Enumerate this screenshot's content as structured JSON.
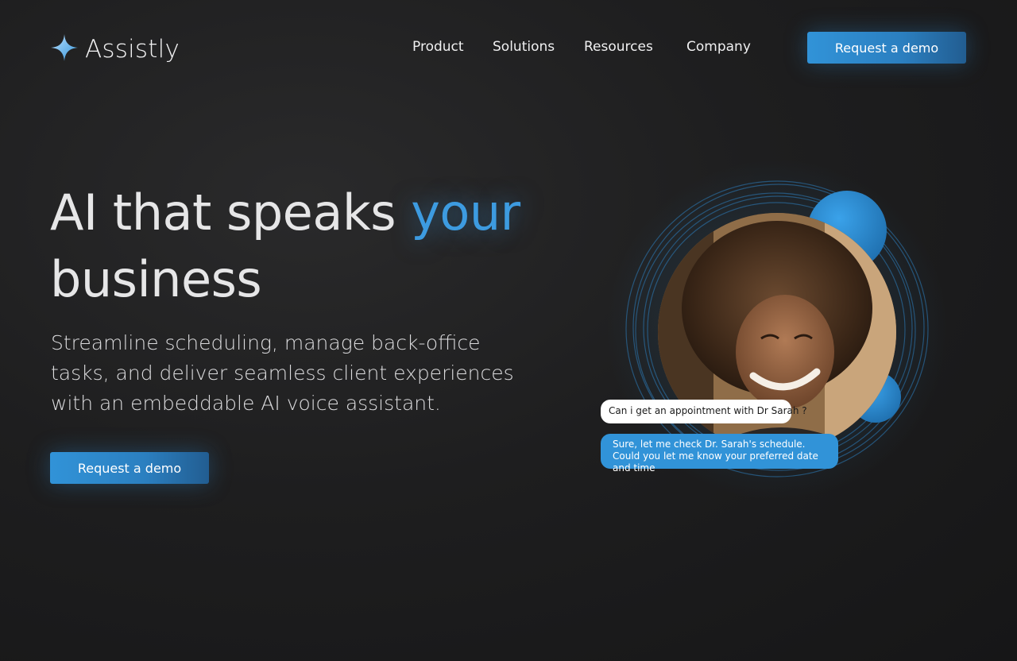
{
  "header": {
    "logo_text": "Assistly",
    "nav": [
      "Product",
      "Solutions",
      "Resources",
      "Company"
    ],
    "cta_label": "Request a demo"
  },
  "hero": {
    "title_part1": "AI that speaks ",
    "title_accent": "your",
    "title_part2": "business",
    "subtitle": "Streamline scheduling, manage back-office tasks, and deliver seamless client experiences with an embeddable AI voice assistant.",
    "cta_label": "Request a demo"
  },
  "chat": {
    "user_message": "Can i get an appointment with Dr Sarah ?",
    "assistant_message": "Sure, let me check Dr. Sarah's schedule. Could you let me know your preferred date and time"
  },
  "colors": {
    "accent": "#3193d8",
    "background": "#1e1e1f",
    "text": "#e6e6e7"
  },
  "icons": {
    "logo": "sparkle-star-icon"
  }
}
